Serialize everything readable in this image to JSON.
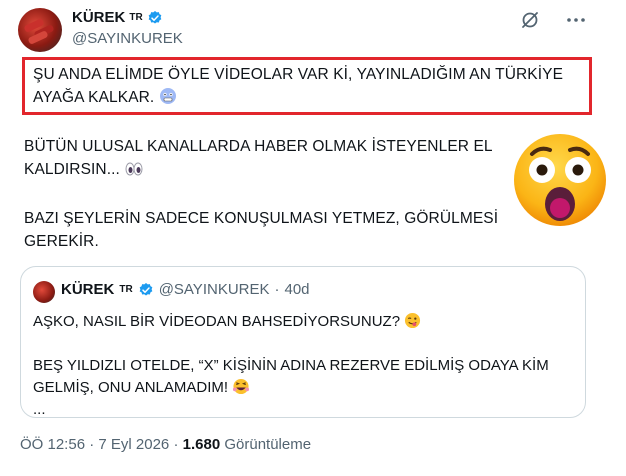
{
  "author": {
    "name": "KÜREK",
    "country_badge": "TR",
    "handle": "@SAYINKUREK",
    "verified": true
  },
  "top_icons": [
    "grok-slash-icon",
    "more-icon"
  ],
  "post": {
    "paragraph1": "ŞU ANDA ELİMDE ÖYLE VİDEOLAR VAR Kİ, YAYINLADIĞIM AN TÜRKİYE AYAĞA KALKAR.",
    "paragraph2": "BÜTÜN ULUSAL KANALLARDA HABER OLMAK İSTEYENLER EL KALDIRSIN...",
    "paragraph3": "BAZI ŞEYLERİN SADECE KONUŞULMASI YETMEZ, GÖRÜLMESİ GEREKİR."
  },
  "quoted": {
    "name": "KÜREK",
    "country_badge": "TR",
    "handle": "@SAYINKUREK",
    "separator": "·",
    "age": "40d",
    "line1": "AŞKO, NASIL BİR VİDEODAN BAHSEDİYORSUNUZ?",
    "line2": "BEŞ YILDIZLI OTELDE, “X” KİŞİNİN ADINA REZERVE EDİLMİŞ ODAYA KİM GELMİŞ, ONU ANLAMADIM!",
    "ellipsis": "..."
  },
  "footer": {
    "time": "ÖÖ 12:56",
    "separator": "·",
    "date": "7 Eyl 2026",
    "separator2": "·",
    "views_count": "1.680",
    "views_label": "Görüntüleme"
  },
  "colors": {
    "highlight_border": "#e2262c",
    "verified_blue": "#1d9bf0",
    "muted_text": "#536471"
  }
}
